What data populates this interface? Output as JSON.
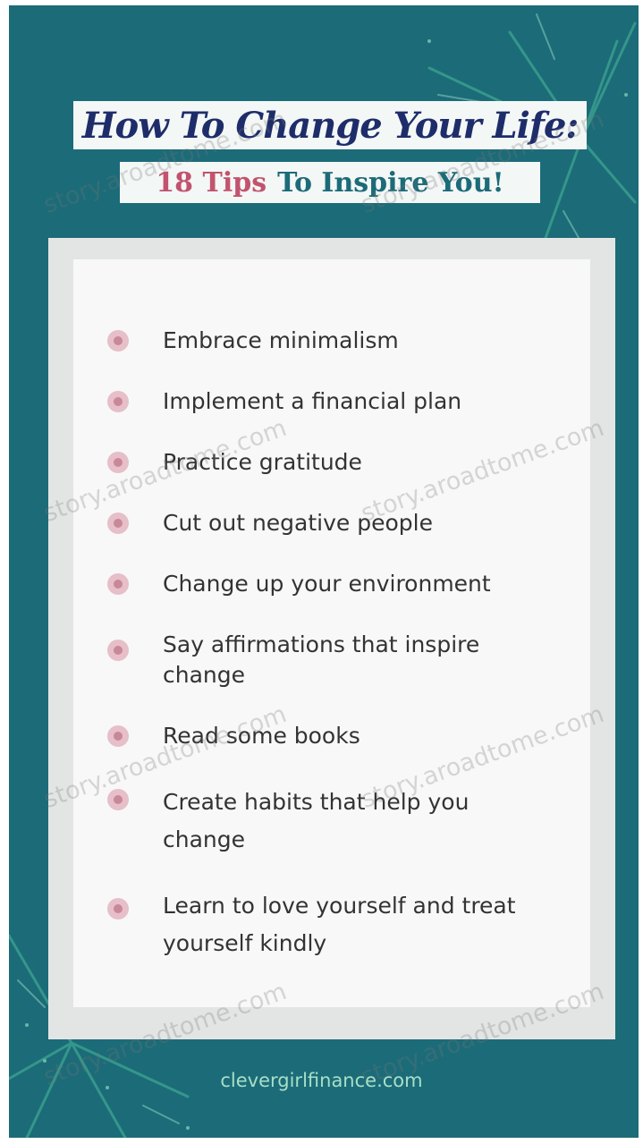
{
  "title": "How To Change Your Life:",
  "subtitle": {
    "accent": "18 Tips",
    "rest": "To Inspire You!"
  },
  "tips": [
    "Embrace minimalism",
    "Implement a financial plan",
    "Practice gratitude",
    "Cut out negative people",
    "Change up your environment",
    "Say affirmations that inspire change",
    "Read some books",
    "Create habits that help you change",
    "Learn to love yourself and treat yourself kindly"
  ],
  "footer": "clevergirlfinance.com",
  "watermark": "story.aroadtome.com",
  "colors": {
    "background": "#1c6b78",
    "title": "#1e2d6a",
    "accent": "#c2536e",
    "bullet": "#e6bfc9",
    "footer": "#a7dfc8"
  },
  "icons": {
    "tip_bullet": "pink-circle-bullet-icon"
  }
}
